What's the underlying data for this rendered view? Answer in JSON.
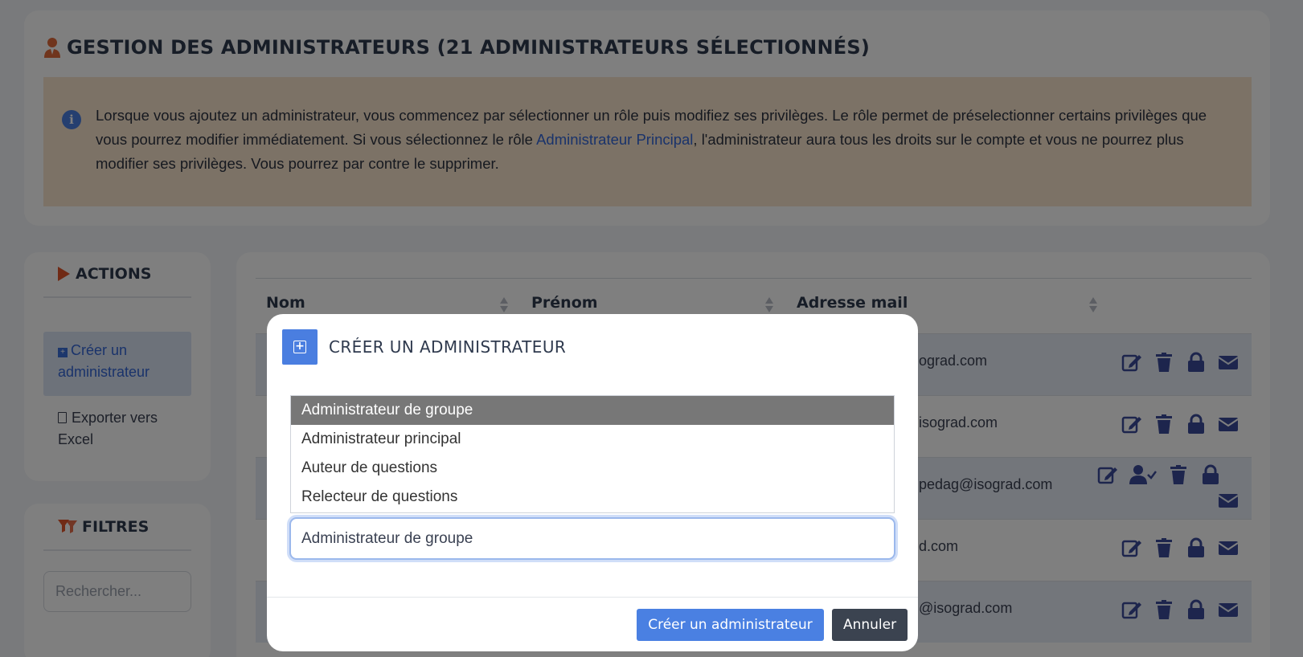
{
  "header": {
    "title": "GESTION DES ADMINISTRATEURS (21 ADMINISTRATEURS SÉLECTIONNÉS)",
    "info_before_link": "Lorsque vous ajoutez un administrateur, vous commencez par sélectionner un rôle puis modifiez ses privilèges. Le rôle permet de préselectionner certains privilèges que vous pourrez modifier immédiatement. Si vous sélectionnez le rôle ",
    "info_link": "Administrateur Principal",
    "info_after_link": ", l'administrateur aura tous les droits sur le compte et vous ne pourrez plus modifier ses privilèges. Vous pourrez par contre le supprimer."
  },
  "actions": {
    "title": "ACTIONS",
    "create_label": "Créer un administrateur",
    "export_label": "Exporter vers Excel"
  },
  "filters": {
    "title": "FILTRES",
    "search_placeholder": "Rechercher..."
  },
  "table": {
    "columns": [
      "Nom",
      "Prénom",
      "Adresse mail"
    ],
    "rows": [
      {
        "email": "ograd.com"
      },
      {
        "email": "isograd.com"
      },
      {
        "email": "pedag@isograd.com"
      },
      {
        "email": "d.com"
      },
      {
        "email": "@isograd.com"
      }
    ]
  },
  "modal": {
    "title": "CRÉER UN ADMINISTRATEUR",
    "options": [
      "Administrateur de groupe",
      "Administrateur principal",
      "Auteur de questions",
      "Relecteur de questions"
    ],
    "selected_index": 0,
    "input_value": "Administrateur de groupe",
    "primary_button": "Créer un administrateur",
    "secondary_button": "Annuler"
  },
  "colors": {
    "accent": "#4a80e2",
    "info_bg": "#f9e4cd",
    "danger_icon": "#e0542b",
    "selected_option_bg": "#777777",
    "secondary_button": "#3b4350"
  }
}
